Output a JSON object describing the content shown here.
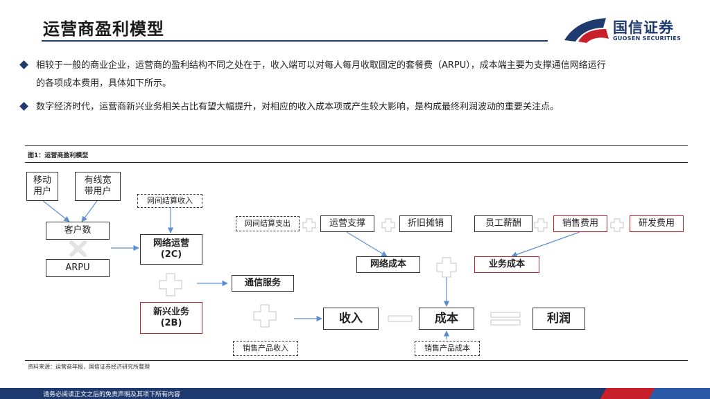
{
  "title": "运营商盈利模型",
  "logo": {
    "cn": "国信证券",
    "en": "GUOSEN SECURITIES",
    "colors": {
      "red": "#c8202a",
      "blue": "#1f3a6e"
    }
  },
  "bullets": [
    {
      "line1": "相较于一般的商业企业，运营商的盈利结构不同之处在于，收入端可以对每人每月收取固定的套餐费（ARPU），成本端主要为支撑通信网络运行",
      "line2": "的各项成本费用，具体如下所示。"
    },
    {
      "line1": "数字经济时代，运营商新兴业务相关占比有望大幅提升，对相应的收入成本项或产生较大影响，是构成最终利润波动的重要关注点。"
    }
  ],
  "figure": {
    "caption": "图1：运营商盈利模型",
    "source": "资料来源：运营商年报，国信证券经济研究所整理",
    "nodes": {
      "mobile_users": "移动\n用户",
      "wired_users": "有线宽\n带用户",
      "customer_count": "客户数",
      "arpu": "ARPU",
      "interconnect_income": "网间结算收入",
      "network_ops": "网络运营\n(2C)",
      "new_business": "新兴业务\n(2B)",
      "telecom_services": "通信服务",
      "sales_income": "销售产品收入",
      "revenue": "收入",
      "interconnect_expense": "网间结算支出",
      "ops_support": "运营支撑",
      "depreciation": "折旧摊销",
      "network_cost": "网络成本",
      "staff_pay": "员工薪酬",
      "sales_expense": "销售费用",
      "rd_expense": "研发费用",
      "business_cost": "业务成本",
      "cost": "成本",
      "sales_cost": "销售产品成本",
      "profit": "利润"
    }
  },
  "footer": "请务必阅读正文之后的免责声明及其项下所有内容"
}
